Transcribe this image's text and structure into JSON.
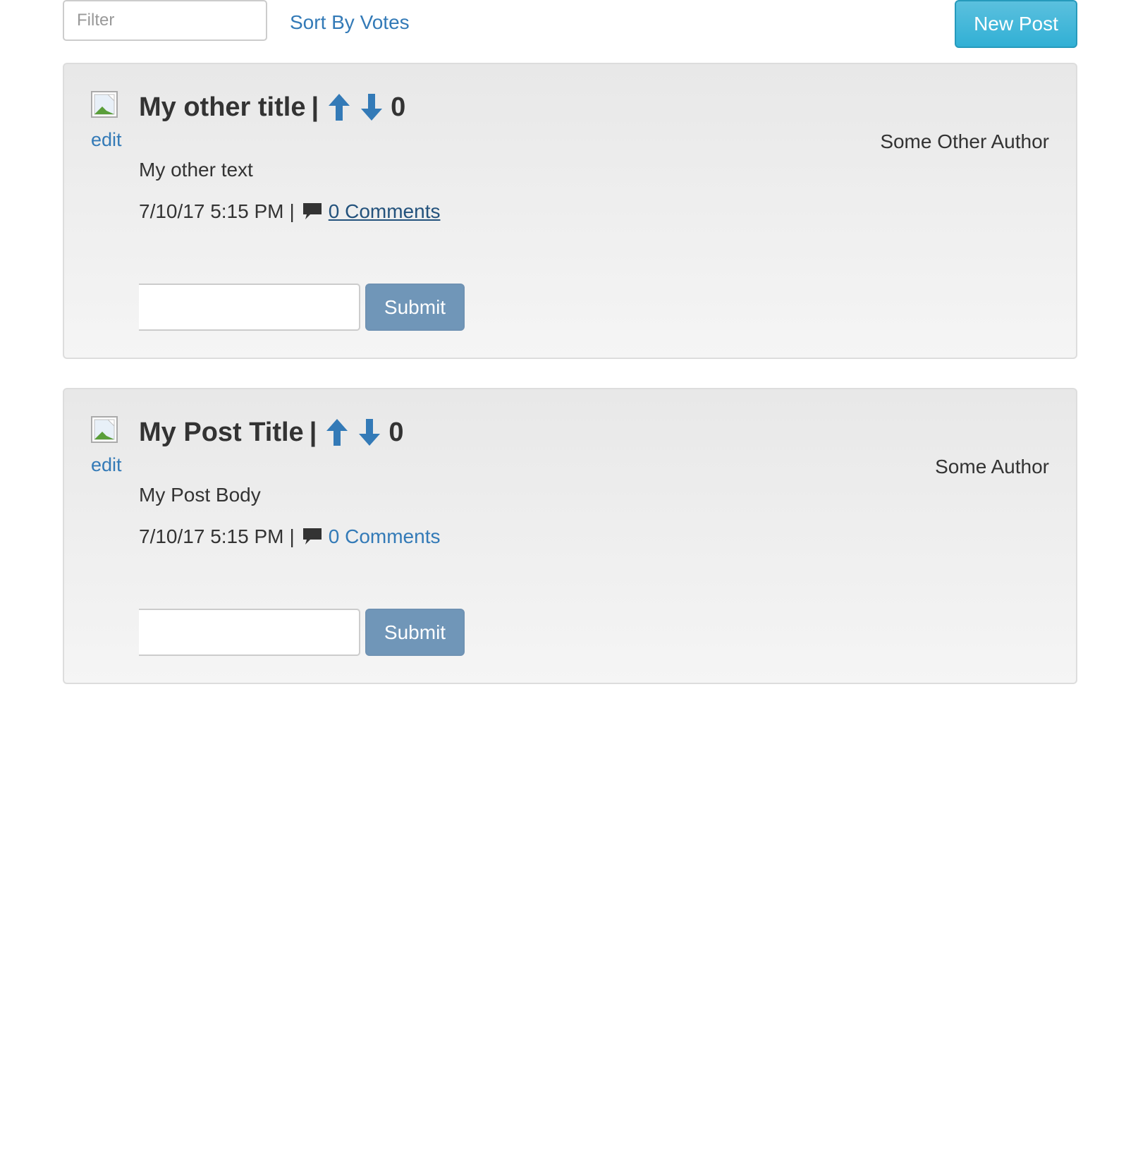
{
  "toolbar": {
    "filter_placeholder": "Filter",
    "sort_label": "Sort By Votes",
    "new_post_label": "New Post"
  },
  "posts": [
    {
      "title": "My other title",
      "separator": "|",
      "votes": "0",
      "author": "Some Other Author",
      "body": "My other text",
      "timestamp": "7/10/17 5:15 PM",
      "comments_label": "0 Comments",
      "edit_label": "edit",
      "submit_label": "Submit"
    },
    {
      "title": "My Post Title",
      "separator": "|",
      "votes": "0",
      "author": "Some Author",
      "body": "My Post Body",
      "timestamp": "7/10/17 5:15 PM",
      "comments_label": "0 Comments",
      "edit_label": "edit",
      "submit_label": "Submit"
    }
  ],
  "icons": {
    "upvote": "arrow-up-icon",
    "downvote": "arrow-down-icon",
    "comment": "comment-icon",
    "thumbnail": "broken-image-icon"
  },
  "colors": {
    "link": "#337ab7",
    "new_post_button": "#31b0d5",
    "submit_button": "#7096b8",
    "card_background": "#eeeeee"
  }
}
